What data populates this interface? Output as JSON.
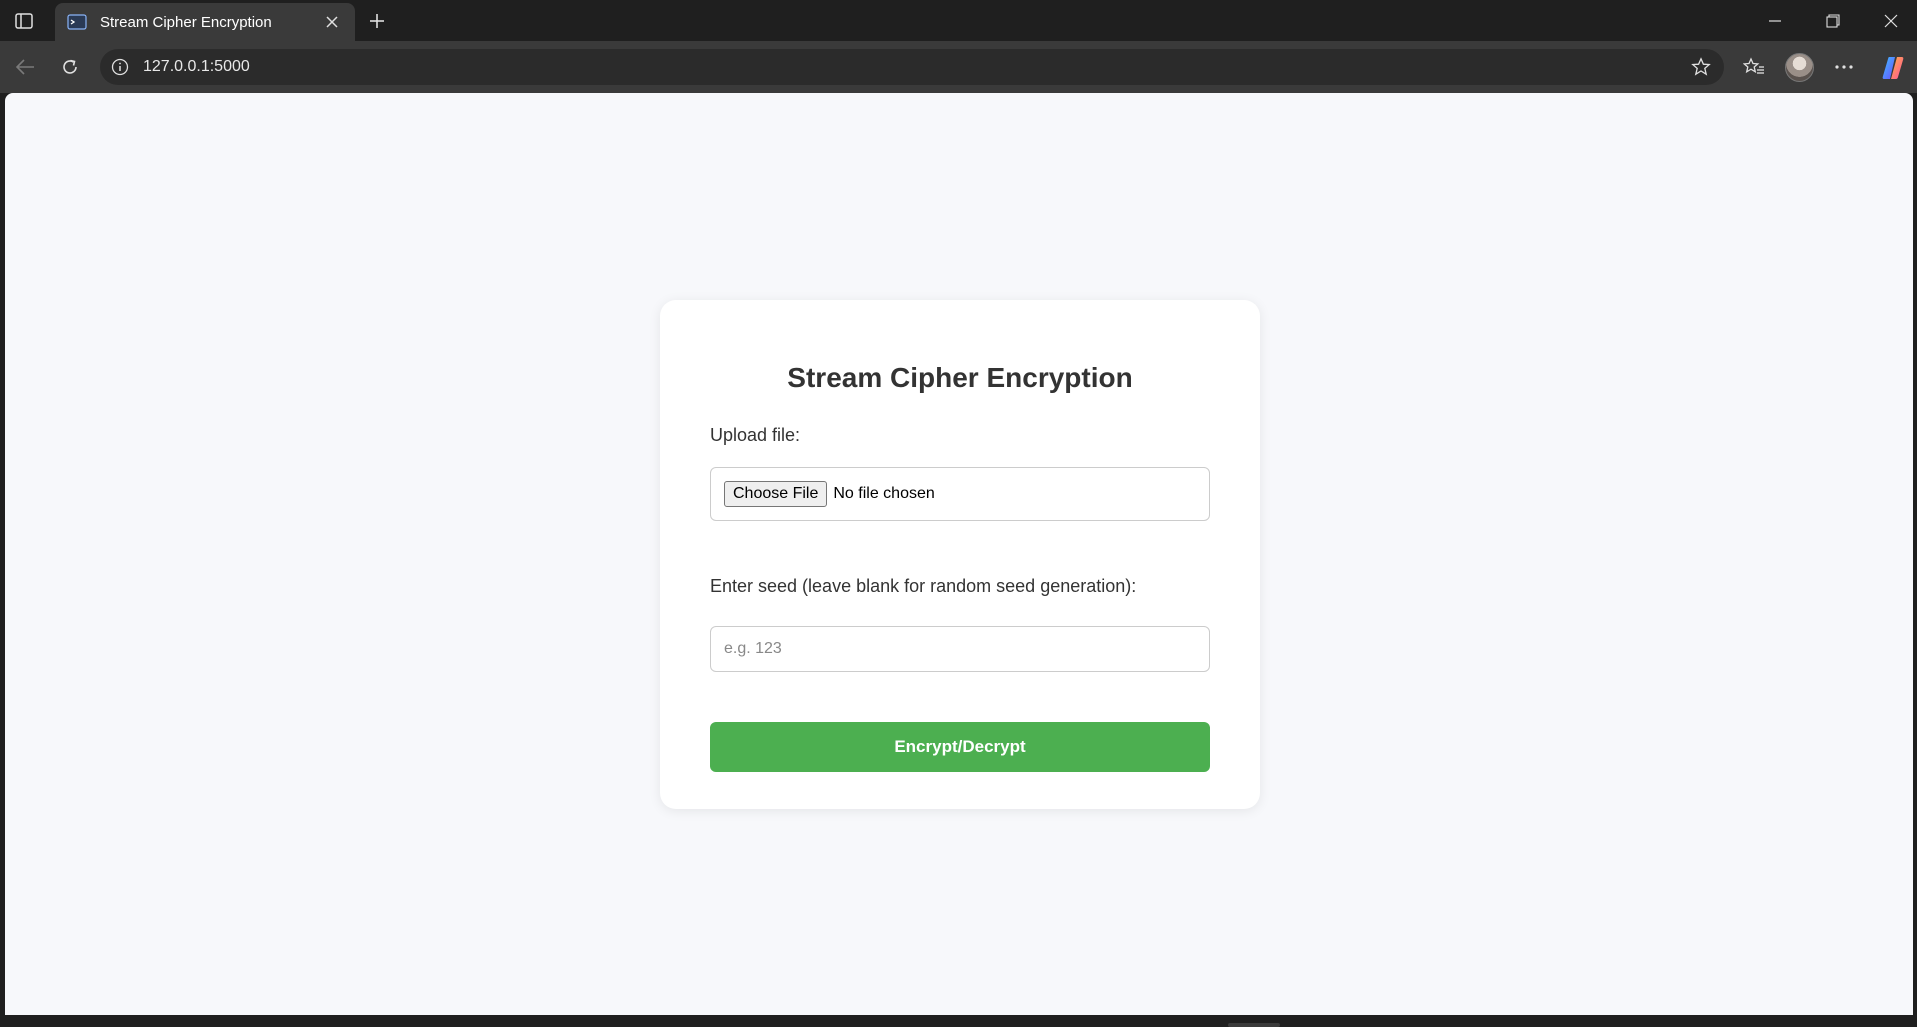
{
  "browser": {
    "tab": {
      "title": "Stream Cipher Encryption"
    },
    "address_bar": {
      "url": "127.0.0.1:5000"
    },
    "icons": {
      "sidebar": "sidebar-toggle-icon",
      "favicon": "terminal-window-icon",
      "close_tab": "close-icon",
      "new_tab": "plus-icon",
      "minimize": "minimize-icon",
      "restore": "restore-icon",
      "close_window": "close-icon",
      "back": "back-arrow-icon",
      "reload": "reload-icon",
      "site_info": "info-icon",
      "favorite": "star-icon",
      "favorites_list": "favorites-icon",
      "more": "more-icon",
      "copilot": "copilot-icon"
    }
  },
  "page": {
    "title": "Stream Cipher Encryption",
    "upload_label": "Upload file:",
    "file_input": {
      "button_label": "Choose File",
      "status": "No file chosen"
    },
    "seed_label": "Enter seed (leave blank for random seed generation):",
    "seed_input": {
      "placeholder": "e.g. 123",
      "value": ""
    },
    "submit_label": "Encrypt/Decrypt",
    "colors": {
      "background": "#f7f8fb",
      "card": "#ffffff",
      "accent": "#4caf50",
      "text": "#333333"
    }
  }
}
